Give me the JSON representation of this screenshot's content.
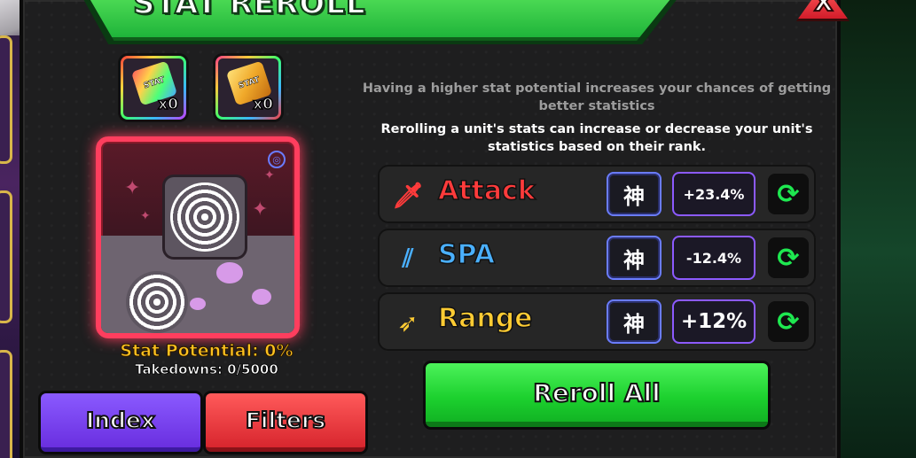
{
  "window": {
    "title": "STAT REROLL",
    "close_label": "X"
  },
  "items": [
    {
      "name": "rainbow-stat-chip",
      "icon_text": "STAT",
      "count": "x0"
    },
    {
      "name": "gold-stat-chip",
      "icon_text": "STAT",
      "count": "x0"
    }
  ],
  "unit": {
    "stat_potential": "Stat Potential: 0%",
    "takedowns": "Takedowns: 0/5000"
  },
  "buttons": {
    "index_label": "Index",
    "filters_label": "Filters",
    "reroll_all_label": "Reroll All"
  },
  "info": {
    "line1": "Having a higher stat potential increases your chances of getting better statistics",
    "line2": "Rerolling a unit's stats can increase or decrease your unit's statistics based on their rank."
  },
  "stats": [
    {
      "name": "Attack",
      "color": "#ff3b3b",
      "icon": "sword-icon",
      "rank": "神",
      "value": "+23.4%"
    },
    {
      "name": "SPA",
      "color": "#4ab0ff",
      "icon": "claw-slash-icon",
      "rank": "神",
      "value": "-12.4%"
    },
    {
      "name": "Range",
      "color": "#ffcc33",
      "icon": "bow-icon",
      "rank": "神",
      "value": "+12%"
    }
  ],
  "colors": {
    "accent_green": "#1fd035",
    "card_border": "#ff3e5e",
    "potential_gold": "#ffc21f"
  }
}
